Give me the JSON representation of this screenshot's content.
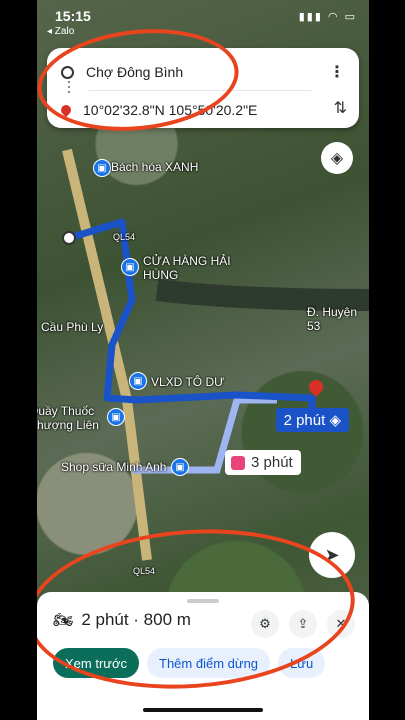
{
  "status_bar": {
    "time": "15:15",
    "back_label": "◂ Zalo",
    "icons": "▮▮▮ ◠ ▭"
  },
  "route_card": {
    "origin": "Chợ Đông Bình",
    "destination": "10°02'32.8\"N 105°50'20.2\"E",
    "more_icon": "⋮",
    "swap_icon": "⇅"
  },
  "map": {
    "labels": [
      "Bách hóa XANH",
      "CỬA HÀNG HẢI HÙNG",
      "Cầu Phù Ly",
      "VLXD TÔ DƯ",
      "Quầy Thuốc Phượng Liên",
      "Shop sữa Minh Anh",
      "Đ. Huyện 53",
      "QL54",
      "QL54"
    ],
    "route_time": "2 phút",
    "alt_route_time": "3 phút"
  },
  "sheet": {
    "summary": "2 phút · 800 m",
    "preview_label": "Xem trước",
    "stops_label": "Thêm điểm dừng",
    "save_label": "Lưu"
  },
  "colors": {
    "route": "#1a53c7",
    "alt_route": "#9fb5f2",
    "accent": "#0b6e5a",
    "annotation": "#e8451f"
  }
}
